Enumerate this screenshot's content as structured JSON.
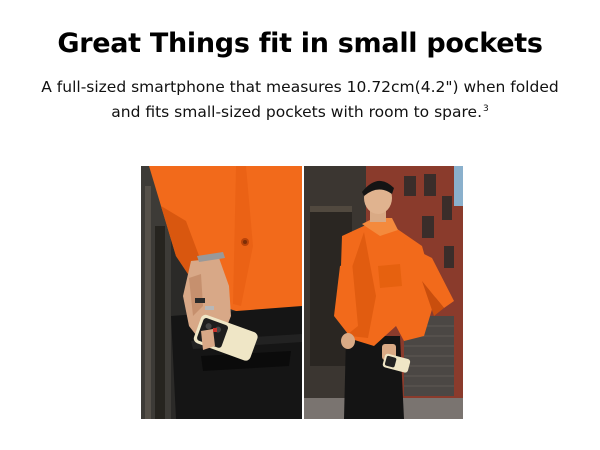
{
  "headline": "Great Things fit in small pockets",
  "description": {
    "text": "A full-sized smartphone that measures 10.72cm(4.2\") when folded and fits small-sized pockets with room to spare.",
    "footnote": "3"
  },
  "photos": {
    "left": {
      "subject": "closeup-hand-pocket-phone"
    },
    "right": {
      "subject": "man-orange-jacket-street"
    }
  },
  "colors": {
    "jacket": "#f26a1b",
    "jacket_shadow": "#c94e0d",
    "pants": "#161616",
    "phone": "#efe6c6",
    "brick": "#8a3b2c"
  }
}
